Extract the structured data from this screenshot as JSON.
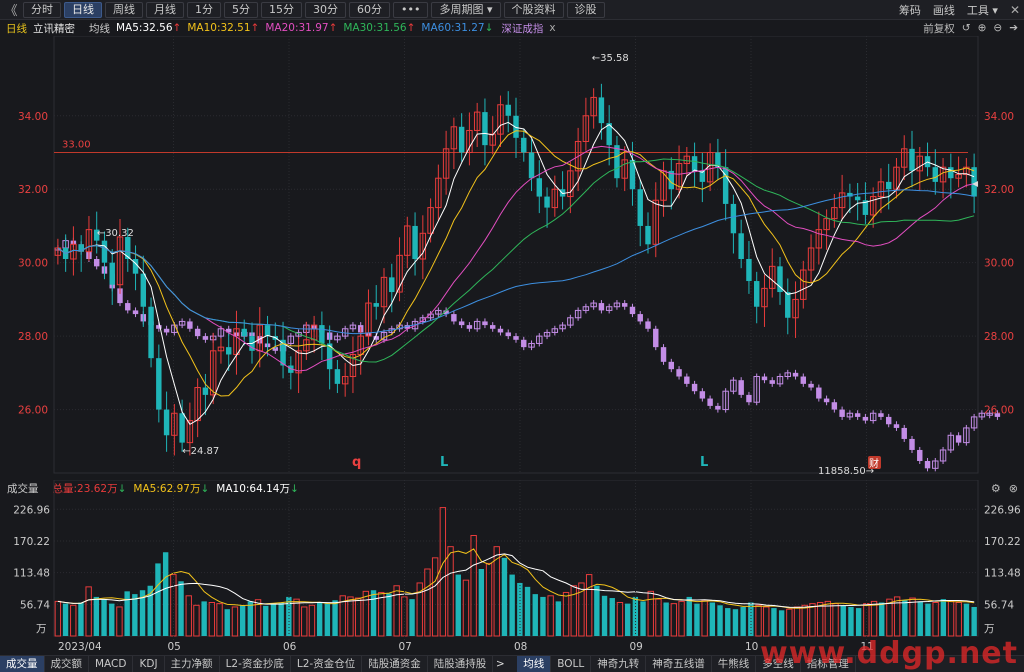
{
  "toolbar": {
    "back": "《",
    "periods": [
      "分时",
      "日线",
      "周线",
      "月线",
      "1分",
      "5分",
      "15分",
      "30分",
      "60分"
    ],
    "active_period": 1,
    "more": "•••",
    "multi_period": "多周期图",
    "stock_info": "个股资料",
    "diagnose": "诊股",
    "right": [
      "筹码",
      "画线",
      "工具"
    ],
    "close": "✕"
  },
  "legend": {
    "period": "日线",
    "stock": "立讯精密",
    "ma_label": "均线",
    "ma5": "MA5:32.56",
    "ma10": "MA10:32.51",
    "ma20": "MA20:31.97",
    "ma30": "MA30:31.56",
    "ma60": "MA60:31.27",
    "index": "深证成指",
    "index_close": "x",
    "adjust": "前复权"
  },
  "colors": {
    "up": "#e83b3b",
    "down": "#1fb5b8",
    "ma5": "#ffffff",
    "ma10": "#f2c21b",
    "ma20": "#e24ec0",
    "ma30": "#2fb65a",
    "ma60": "#3d8fe0",
    "index": "#c38de6",
    "grid": "#2a2b30",
    "arrow_up": "#e83b3b",
    "arrow_down": "#2fb65a"
  },
  "volume": {
    "title": "成交量",
    "total": "总量:23.62万",
    "ma5": "MA5:62.97万",
    "ma10": "MA10:64.14万",
    "unit": "万"
  },
  "tabs": [
    "成交量",
    "成交额",
    "MACD",
    "KDJ",
    "主力净额",
    "L2-资金抄底",
    "L2-资金仓位",
    "陆股通资金",
    "陆股通持股"
  ],
  "tabs_more": ">",
  "tabs_right": [
    "均线",
    "BOLL",
    "神奇九转",
    "神奇五线谱",
    "牛熊线",
    "多空线",
    "指标管理"
  ],
  "watermark": "www.ddgp.net",
  "chart_data": {
    "type": "candlestick",
    "yticks": [
      "34.00",
      "32.00",
      "30.00",
      "28.00",
      "26.00"
    ],
    "ylim": [
      24.3,
      35.9
    ],
    "months": [
      "2023/04",
      "05",
      "06",
      "07",
      "08",
      "09",
      "10",
      "11"
    ],
    "hline_label": "33.00",
    "hline_value": 33.0,
    "high_label": "35.58",
    "low_label": "24.87",
    "start_label": "30.32",
    "index_low_label": "11858.50",
    "signal_marks": [
      "q",
      "L",
      "L"
    ],
    "finance_mark": "财",
    "vol_yticks": [
      "226.96",
      "170.22",
      "113.48",
      "56.74"
    ],
    "vol_max": 240,
    "closes": [
      30.4,
      30.1,
      30.5,
      30.3,
      30.9,
      30.6,
      30.0,
      29.4,
      30.7,
      30.1,
      29.7,
      28.8,
      27.4,
      26.0,
      25.3,
      25.9,
      25.1,
      25.7,
      26.6,
      26.4,
      27.6,
      27.7,
      27.5,
      28.2,
      28.0,
      27.6,
      28.3,
      28.0,
      27.9,
      27.2,
      27.0,
      27.6,
      27.9,
      28.3,
      27.8,
      27.1,
      26.7,
      26.9,
      27.5,
      28.0,
      28.9,
      28.8,
      29.6,
      29.2,
      30.2,
      31.0,
      30.1,
      30.8,
      31.5,
      32.3,
      33.1,
      33.7,
      33.0,
      33.6,
      34.1,
      33.2,
      33.5,
      34.3,
      34.0,
      33.4,
      33.0,
      32.3,
      31.8,
      31.5,
      32.0,
      31.8,
      32.5,
      33.3,
      34.0,
      34.5,
      33.8,
      33.2,
      32.3,
      32.8,
      32.0,
      31.0,
      30.5,
      31.7,
      32.5,
      32.0,
      32.7,
      32.9,
      32.5,
      32.2,
      33.0,
      32.6,
      31.6,
      30.8,
      30.1,
      29.5,
      28.8,
      29.3,
      29.9,
      29.2,
      28.5,
      29.0,
      29.8,
      30.4,
      30.9,
      31.2,
      31.5,
      31.9,
      31.8,
      31.7,
      31.3,
      31.8,
      32.2,
      32.0,
      32.6,
      33.1,
      32.5,
      32.9,
      32.6,
      32.2,
      32.6,
      32.3,
      32.4,
      32.6,
      31.8
    ],
    "volumes": [
      62,
      58,
      55,
      60,
      88,
      70,
      66,
      58,
      52,
      80,
      75,
      82,
      90,
      130,
      150,
      110,
      98,
      72,
      55,
      62,
      60,
      58,
      48,
      52,
      55,
      62,
      65,
      54,
      58,
      60,
      70,
      66,
      52,
      55,
      60,
      58,
      64,
      72,
      70,
      68,
      80,
      82,
      78,
      76,
      90,
      70,
      66,
      95,
      120,
      140,
      230,
      160,
      110,
      100,
      180,
      120,
      130,
      160,
      140,
      110,
      95,
      88,
      75,
      70,
      72,
      62,
      78,
      90,
      95,
      110,
      90,
      72,
      68,
      60,
      58,
      70,
      62,
      80,
      66,
      60,
      58,
      62,
      70,
      58,
      64,
      60,
      55,
      50,
      48,
      52,
      60,
      55,
      52,
      50,
      46,
      48,
      52,
      55,
      58,
      60,
      62,
      58,
      55,
      52,
      50,
      58,
      62,
      60,
      66,
      70,
      64,
      68,
      62,
      58,
      60,
      66,
      62,
      60,
      58,
      52
    ],
    "index_values": [
      30.4,
      30.6,
      30.5,
      30.3,
      30.1,
      29.9,
      29.7,
      29.3,
      28.9,
      28.7,
      28.6,
      28.4,
      28.3,
      28.2,
      28.1,
      28.3,
      28.4,
      28.2,
      28.0,
      27.9,
      28.0,
      28.2,
      28.1,
      28.0,
      28.1,
      28.0,
      27.8,
      27.7,
      27.6,
      27.8,
      28.0,
      28.1,
      28.3,
      28.2,
      28.1,
      27.9,
      28.0,
      28.2,
      28.3,
      28.1,
      28.0,
      27.9,
      28.1,
      28.2,
      28.3,
      28.2,
      28.4,
      28.5,
      28.6,
      28.7,
      28.6,
      28.4,
      28.3,
      28.2,
      28.4,
      28.3,
      28.2,
      28.1,
      28.0,
      27.9,
      27.7,
      27.8,
      28.0,
      28.1,
      28.2,
      28.3,
      28.5,
      28.7,
      28.8,
      28.9,
      28.7,
      28.8,
      28.9,
      28.8,
      28.6,
      28.4,
      28.2,
      27.7,
      27.3,
      27.1,
      26.9,
      26.7,
      26.5,
      26.3,
      26.1,
      26.0,
      26.5,
      26.8,
      26.4,
      26.2,
      26.9,
      26.8,
      26.7,
      26.9,
      27.0,
      26.9,
      26.7,
      26.6,
      26.3,
      26.2,
      26.0,
      25.8,
      25.9,
      25.8,
      25.7,
      25.9,
      25.8,
      25.6,
      25.5,
      25.2,
      24.9,
      24.6,
      24.4,
      24.6,
      24.9,
      25.3,
      25.1,
      25.5,
      25.8,
      25.9,
      25.9,
      25.8
    ]
  }
}
